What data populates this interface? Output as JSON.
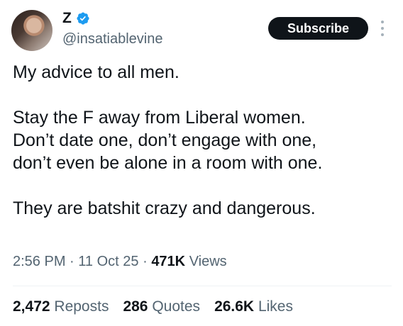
{
  "author": {
    "display_name": "Z",
    "handle": "@insatiablevine",
    "verified": true
  },
  "subscribe_label": "Subscribe",
  "tweet_lines": [
    "My advice to all men.",
    "",
    "Stay the F away from Liberal women.",
    "Don’t date one, don’t engage with one,",
    "don’t even be alone in a room with one.",
    "",
    "They are batshit crazy and dangerous."
  ],
  "meta": {
    "time": "2:56 PM",
    "date": "11 Oct 25",
    "views_count": "471K",
    "views_label": "Views",
    "separator": "·"
  },
  "stats": {
    "reposts_count": "2,472",
    "reposts_label": "Reposts",
    "quotes_count": "286",
    "quotes_label": "Quotes",
    "likes_count": "26.6K",
    "likes_label": "Likes"
  },
  "colors": {
    "verified_badge": "#1d9bf0",
    "text_primary": "#0f1419",
    "text_secondary": "#536471",
    "button_bg": "#0f1419"
  },
  "icons": {
    "verified": "verified-badge-icon",
    "more": "more-vertical-icon"
  }
}
